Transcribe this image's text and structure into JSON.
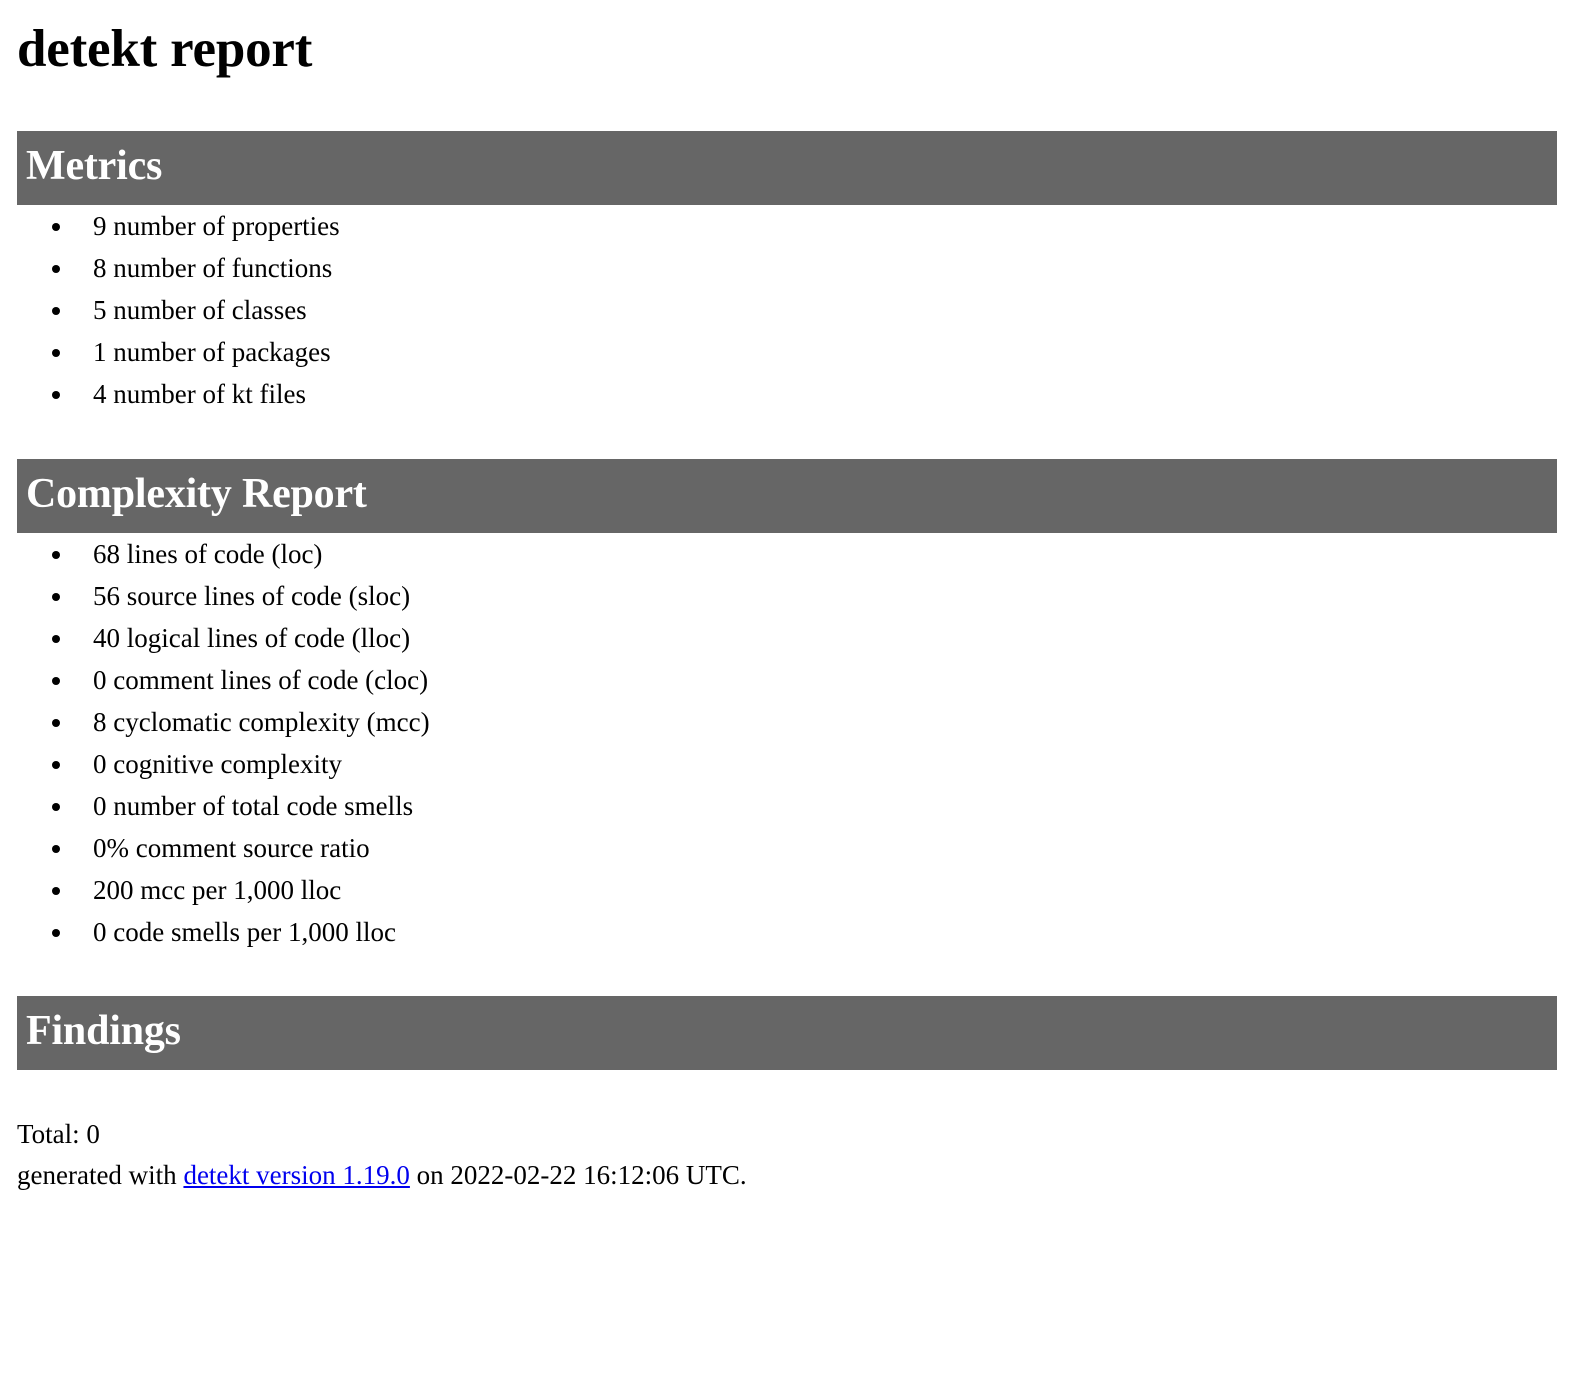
{
  "document": {
    "title": "detekt report",
    "accent_bar_color": "#666666",
    "link_color": "#0000ee",
    "background_color": "#ffffff",
    "text_color": "#000000"
  },
  "sections": {
    "metrics": {
      "heading": "Metrics",
      "items": [
        "9 number of properties",
        "8 number of functions",
        "5 number of classes",
        "1 number of packages",
        "4 number of kt files"
      ]
    },
    "complexity": {
      "heading": "Complexity Report",
      "items": [
        "68 lines of code (loc)",
        "56 source lines of code (sloc)",
        "40 logical lines of code (lloc)",
        "0 comment lines of code (cloc)",
        "8 cyclomatic complexity (mcc)",
        "0 cognitive complexity",
        "0 number of total code smells",
        "0% comment source ratio",
        "200 mcc per 1,000 lloc",
        "0 code smells per 1,000 lloc"
      ]
    },
    "findings": {
      "heading": "Findings",
      "total_label": "Total: 0"
    }
  },
  "footer": {
    "prefix": "generated with ",
    "link_text": "detekt version 1.19.0",
    "suffix": " on 2022-02-22 16:12:06 UTC."
  }
}
